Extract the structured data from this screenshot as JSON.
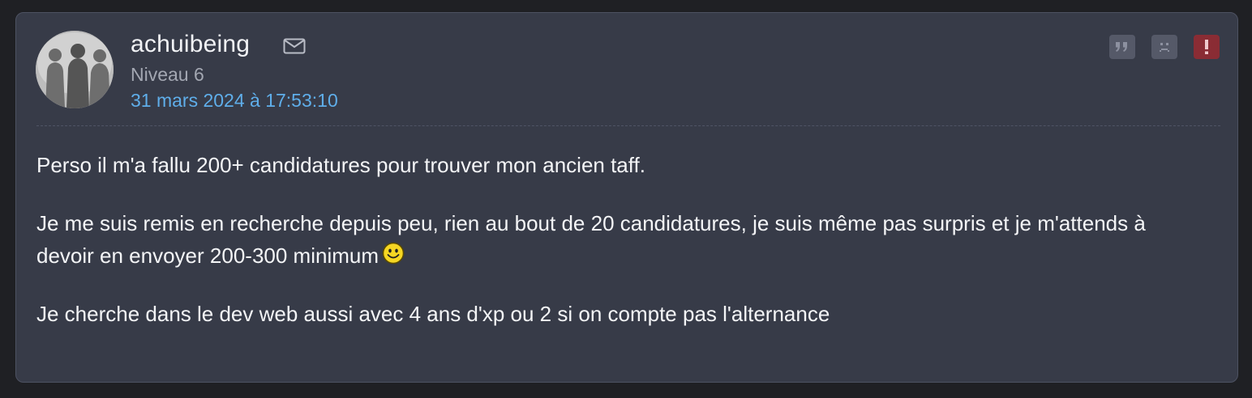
{
  "post": {
    "author": {
      "username": "achuibeing",
      "level": "Niveau 6",
      "date": "31 mars 2024 à 17:53:10"
    },
    "icons": {
      "avatar": "avatar-image",
      "mail": "mail-icon",
      "quote": "quote-icon",
      "sad": "sad-face-icon",
      "report": "exclamation-icon",
      "emoji": "smiley-emoji"
    },
    "colors": {
      "background": "#373b48",
      "username": "#f1f2f5",
      "level": "#a3a7b2",
      "date": "#5faeea",
      "report_button": "#8a2c34",
      "action_button": "#555968"
    },
    "paragraphs": [
      "Perso il m'a fallu 200+ candidatures pour trouver mon ancien taff.",
      "Je me suis remis en recherche depuis peu, rien au bout de 20 candidatures, je suis même pas surpris et je m'attends à devoir en envoyer 200-300 minimum",
      "Je cherche dans le dev web aussi avec 4 ans d'xp ou 2 si on compte pas l'alternance"
    ]
  }
}
